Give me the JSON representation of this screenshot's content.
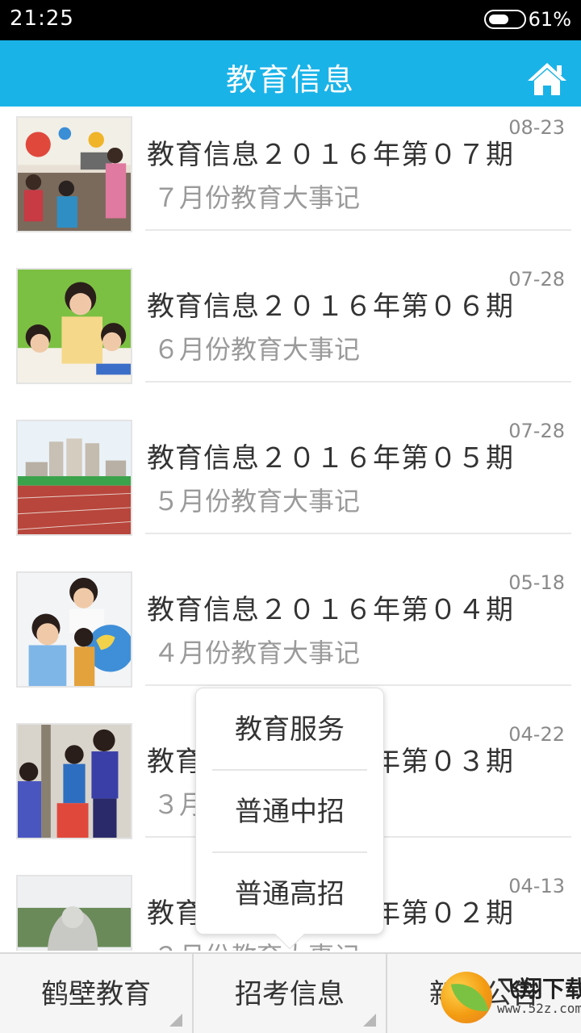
{
  "status_bar": {
    "time": "21:25",
    "battery_percent": "61%",
    "battery_level": 0.61
  },
  "header": {
    "title": "教育信息",
    "home_icon": "home-icon"
  },
  "items": [
    {
      "title": "教育信息２０１６年第０７期",
      "subtitle": "７月份教育大事记",
      "date": "08-23",
      "image": "classroom-photo"
    },
    {
      "title": "教育信息２０１６年第０６期",
      "subtitle": "６月份教育大事记",
      "date": "07-28",
      "image": "teacher-children-photo"
    },
    {
      "title": "教育信息２０１６年第０５期",
      "subtitle": "５月份教育大事记",
      "date": "07-28",
      "image": "running-track-photo"
    },
    {
      "title": "教育信息２０１６年第０４期",
      "subtitle": "４月份教育大事记",
      "date": "05-18",
      "image": "children-globe-photo"
    },
    {
      "title": "教育信息２０１６年第０３期",
      "subtitle": "３月份教育大事记",
      "date": "04-22",
      "image": "outdoor-activity-photo"
    },
    {
      "title": "教育信息２０１６年第０２期",
      "subtitle": "２月份教育大事记",
      "date": "04-13",
      "image": "sculpture-photo"
    }
  ],
  "popup_menu": {
    "options": [
      "教育服务",
      "普通中招",
      "普通高招"
    ]
  },
  "bottom_nav": {
    "tabs": [
      "鹤壁教育",
      "招考信息",
      "新闻公告"
    ],
    "active_index": 1
  },
  "watermark": {
    "text": "飞翔下载",
    "url": "www.52z.com"
  },
  "colors": {
    "header": "#1ab3e8",
    "status_bar": "#000000",
    "title_text": "#333333",
    "subtitle_text": "#9a9a9a",
    "date_text": "#8a8a8a"
  }
}
